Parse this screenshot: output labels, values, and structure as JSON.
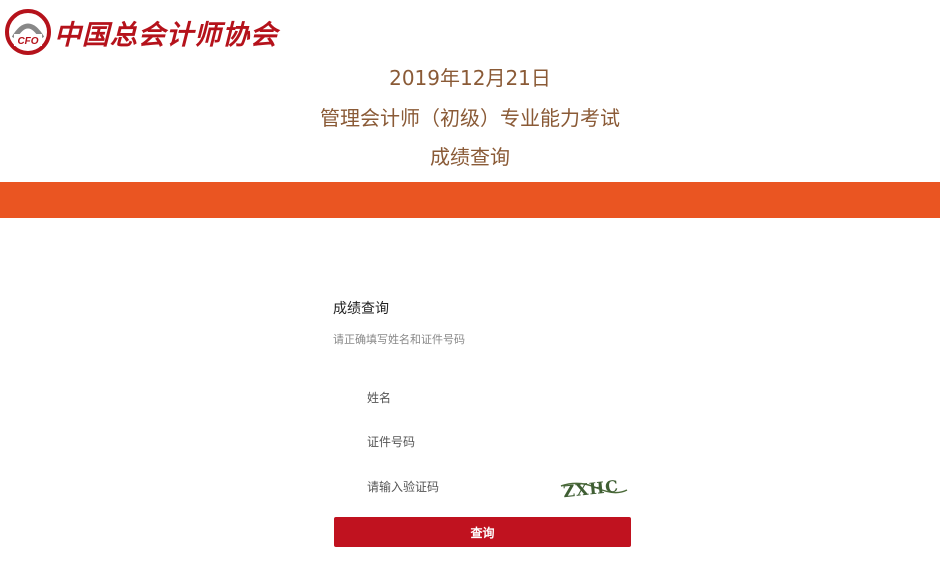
{
  "header": {
    "logo_emblem_text": "CFO",
    "logo_text": "中国总会计师协会",
    "title_date": "2019年12月21日",
    "title_exam": "管理会计师（初级）专业能力考试",
    "title_result": "成绩查询"
  },
  "form": {
    "title": "成绩查询",
    "subtitle": "请正确填写姓名和证件号码",
    "name_placeholder": "姓名",
    "id_placeholder": "证件号码",
    "captcha_placeholder": "请输入验证码",
    "captcha_text": "ZXHC",
    "submit_label": "查询"
  },
  "colors": {
    "brand_red": "#b5121b",
    "band_orange": "#ea5522",
    "title_brown": "#8a5a36",
    "button_red": "#c0121f"
  }
}
